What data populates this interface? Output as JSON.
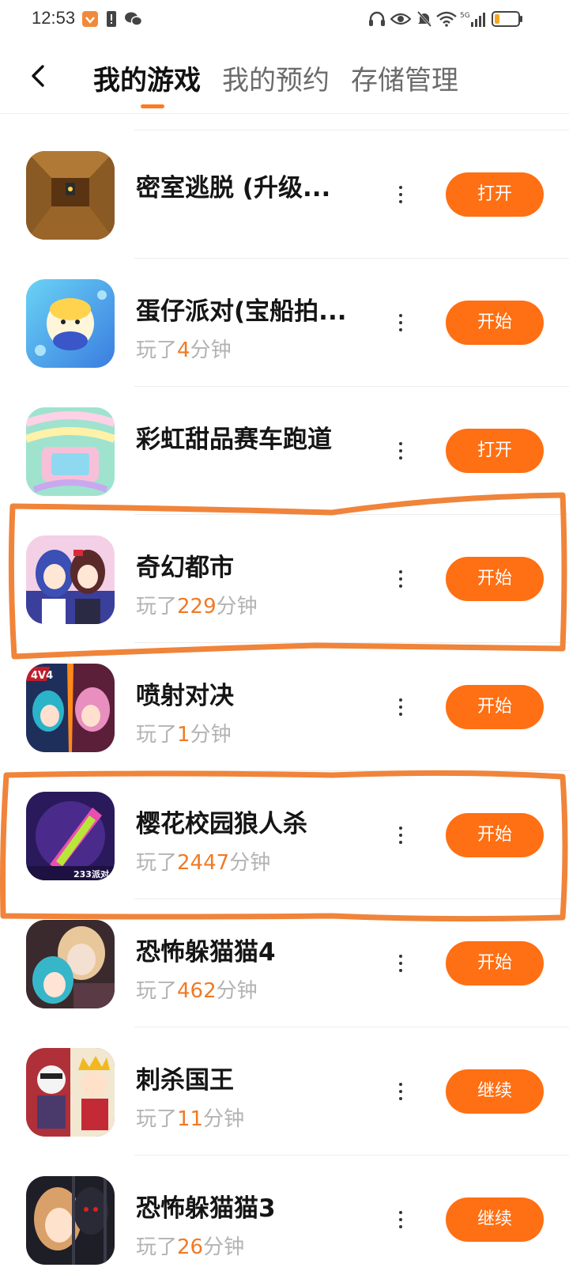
{
  "status_bar": {
    "time": "12:53",
    "icons": [
      "baidu-app-icon",
      "sim-alert-icon",
      "wechat-icon",
      "headphones-icon",
      "eye-icon",
      "mute-icon",
      "wifi-icon",
      "signal-5g-icon",
      "battery-icon"
    ]
  },
  "header": {
    "back_icon": "chevron-left-icon",
    "tabs": [
      {
        "label": "我的游戏",
        "active": true
      },
      {
        "label": "我的预约",
        "active": false
      },
      {
        "label": "存储管理",
        "active": false
      }
    ],
    "accent_color": "#ff6f13"
  },
  "games": [
    {
      "name": "密室逃脱 (升级...",
      "action": "打开",
      "icon": "escape-room-icon"
    },
    {
      "name": "蛋仔派对(宝船拍...",
      "played_prefix": "玩了",
      "played_minutes": "4",
      "played_unit": "分钟",
      "action": "开始",
      "icon": "eggy-party-icon"
    },
    {
      "name": "彩虹甜品赛车跑道",
      "action": "打开",
      "icon": "rainbow-track-icon"
    },
    {
      "name": "奇幻都市",
      "played_prefix": "玩了",
      "played_minutes": "229",
      "played_unit": "分钟",
      "action": "开始",
      "icon": "fantasy-city-icon"
    },
    {
      "name": "喷射对决",
      "played_prefix": "玩了",
      "played_minutes": "1",
      "played_unit": "分钟",
      "action": "开始",
      "icon": "jet-duel-icon",
      "badge": "4V4"
    },
    {
      "name": "樱花校园狼人杀",
      "played_prefix": "玩了",
      "played_minutes": "2447",
      "played_unit": "分钟",
      "action": "开始",
      "icon": "sakura-werewolf-icon",
      "badge": "233派对"
    },
    {
      "name": "恐怖躲猫猫4",
      "played_prefix": "玩了",
      "played_minutes": "462",
      "played_unit": "分钟",
      "action": "开始",
      "icon": "horror-hide-seek-4-icon"
    },
    {
      "name": "刺杀国王",
      "played_prefix": "玩了",
      "played_minutes": "11",
      "played_unit": "分钟",
      "action": "继续",
      "icon": "kill-king-icon"
    },
    {
      "name": "恐怖躲猫猫3",
      "played_prefix": "玩了",
      "played_minutes": "26",
      "played_unit": "分钟",
      "action": "继续",
      "icon": "horror-hide-seek-3-icon"
    }
  ],
  "highlight_color": "#f0843a"
}
